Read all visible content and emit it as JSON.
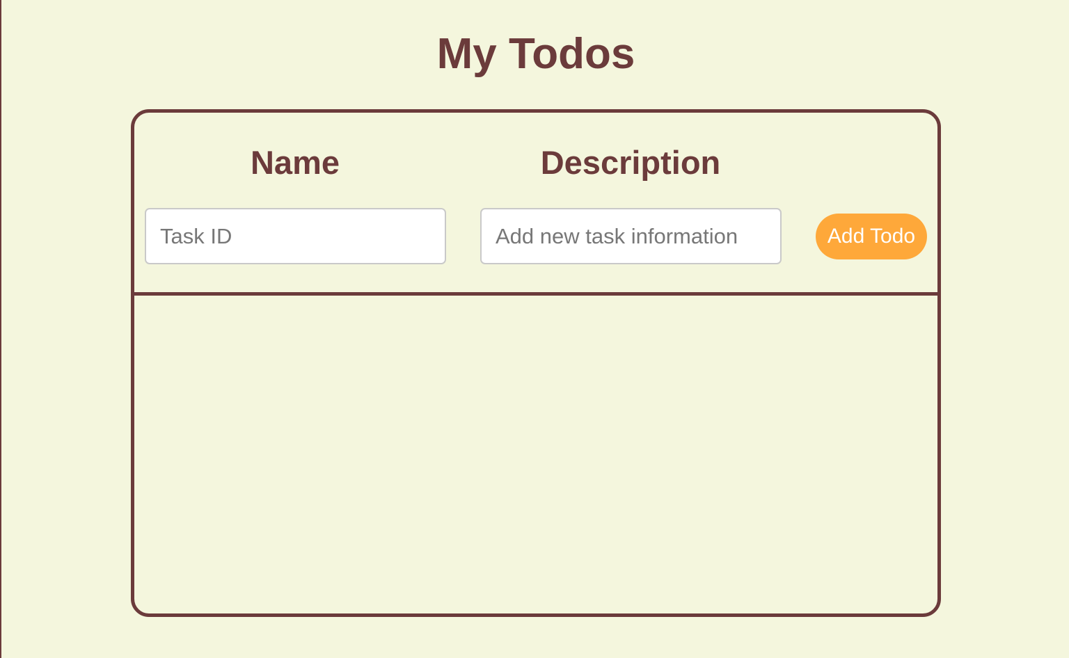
{
  "page": {
    "title": "My Todos"
  },
  "form": {
    "name_header": "Name",
    "description_header": "Description",
    "name_input": {
      "value": "",
      "placeholder": "Task ID"
    },
    "description_input": {
      "value": "",
      "placeholder": "Add new task information"
    },
    "add_button_label": "Add Todo"
  },
  "todos": [],
  "colors": {
    "background": "#f4f6dd",
    "primary": "#6b3b3b",
    "accent": "#fea83a",
    "button_text": "#ffffff"
  }
}
